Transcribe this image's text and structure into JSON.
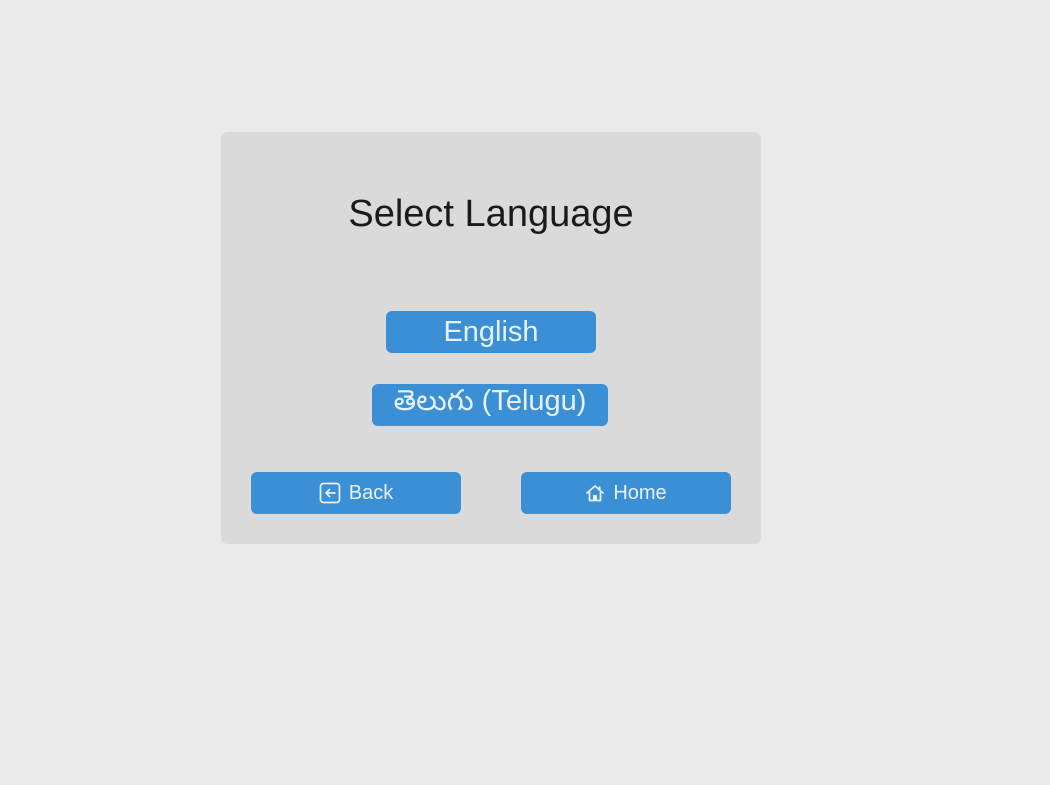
{
  "page": {
    "title": "Select Language"
  },
  "languages": [
    {
      "label": "English"
    },
    {
      "label": "తెలుగు (Telugu)"
    }
  ],
  "nav": {
    "back_label": "Back",
    "back_icon": "back-arrow-box-icon",
    "home_label": "Home",
    "home_icon": "home-icon"
  },
  "colors": {
    "background": "#eaeaea",
    "panel": "#dadada",
    "button": "#3a8fd5",
    "button_text": "#e8f1fa",
    "title_text": "#1a1a1a"
  }
}
